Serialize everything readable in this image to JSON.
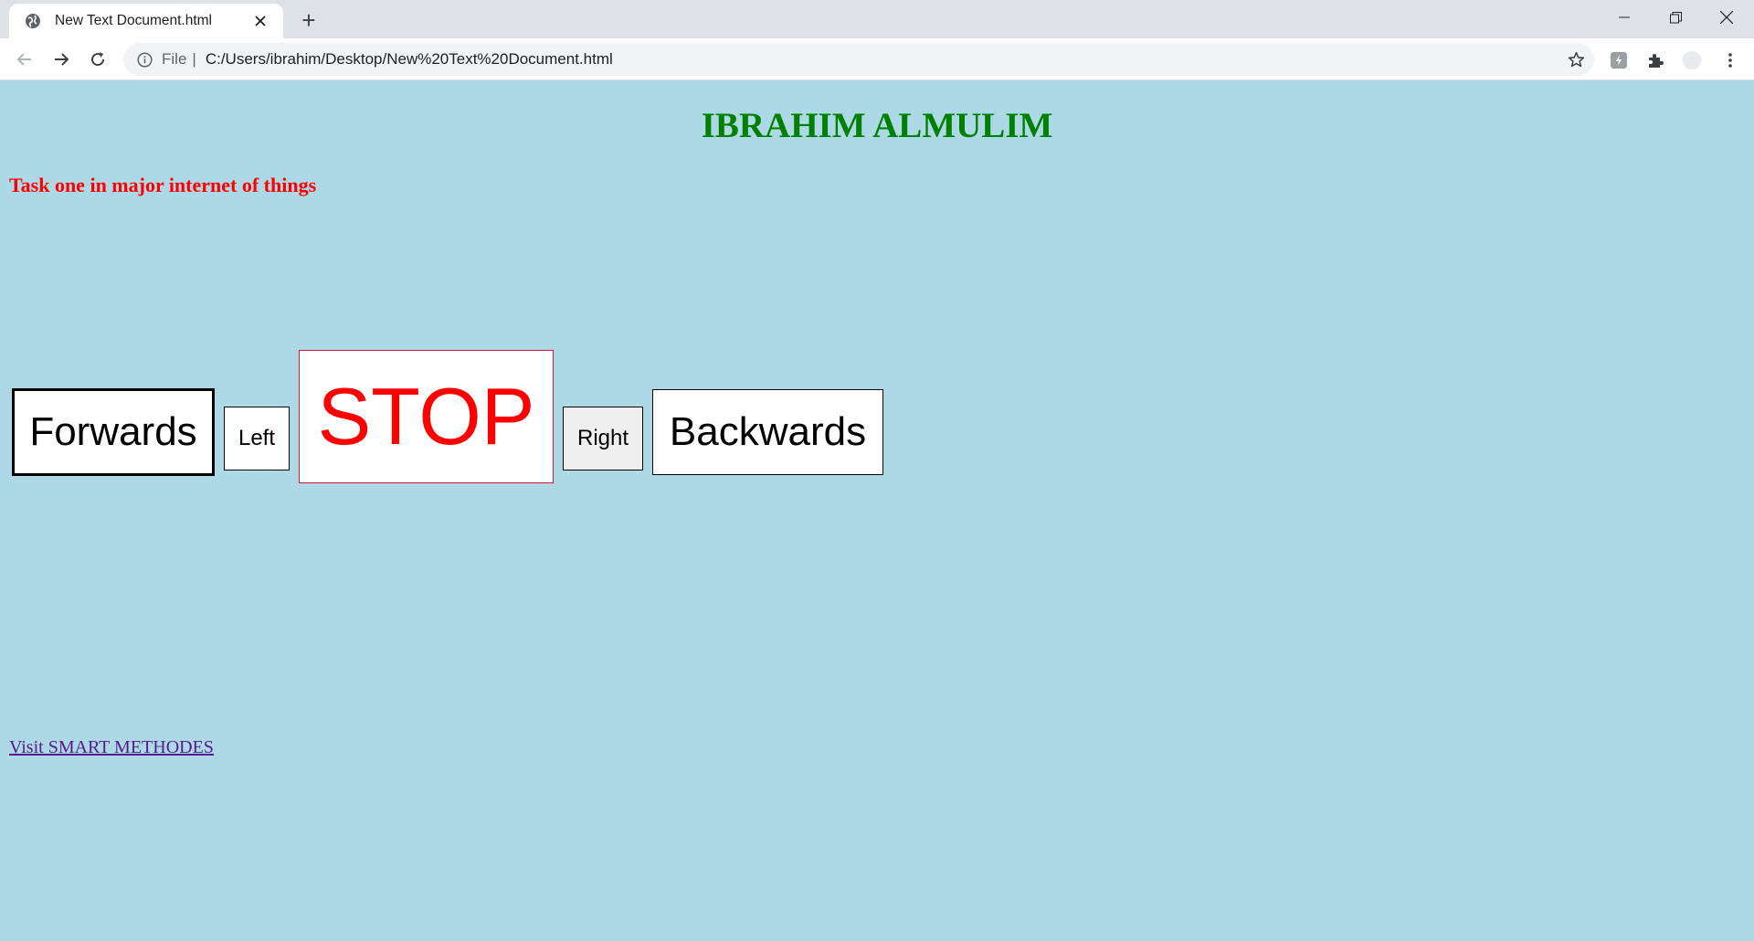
{
  "browser": {
    "tab_title": "New Text Document.html",
    "tab_icon": "globe-icon",
    "new_tab_label": "+",
    "address": {
      "scheme_label": "File",
      "separator": "|",
      "url": "C:/Users/ibrahim/Desktop/New%20Text%20Document.html"
    }
  },
  "page": {
    "heading": "IBRAHIM ALMULIM",
    "subheading": "Task one in major internet of things",
    "controls": {
      "forwards": "Forwards",
      "left": "Left",
      "stop": "STOP",
      "right": "Right",
      "backwards": "Backwards"
    },
    "link": "Visit SMART METHODES"
  },
  "colors": {
    "page_background": "#add8e6",
    "heading": "#008000",
    "subheading": "#ff0000",
    "stop_text": "#ff0000",
    "stop_border": "#dc143c",
    "link": "#551a8b"
  }
}
